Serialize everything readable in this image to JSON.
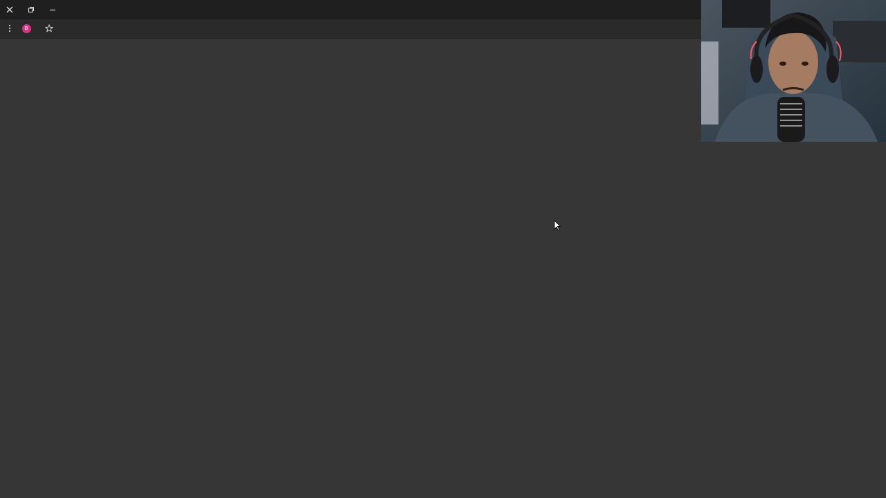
{
  "window": {
    "close_icon": "close-icon",
    "restore_icon": "restore-icon",
    "minimize_icon": "minimize-icon"
  },
  "toolbar": {
    "menu_icon": "kebab-menu-icon",
    "profile": {
      "initial": "B",
      "color": "#d63384"
    },
    "bookmark_icon": "star-icon"
  },
  "colors": {
    "titlebar": "#1f1f1f",
    "toolbar": "#2a2a2a",
    "content": "#363636"
  },
  "webcam": {
    "description_icon": "webcam-overlay"
  }
}
